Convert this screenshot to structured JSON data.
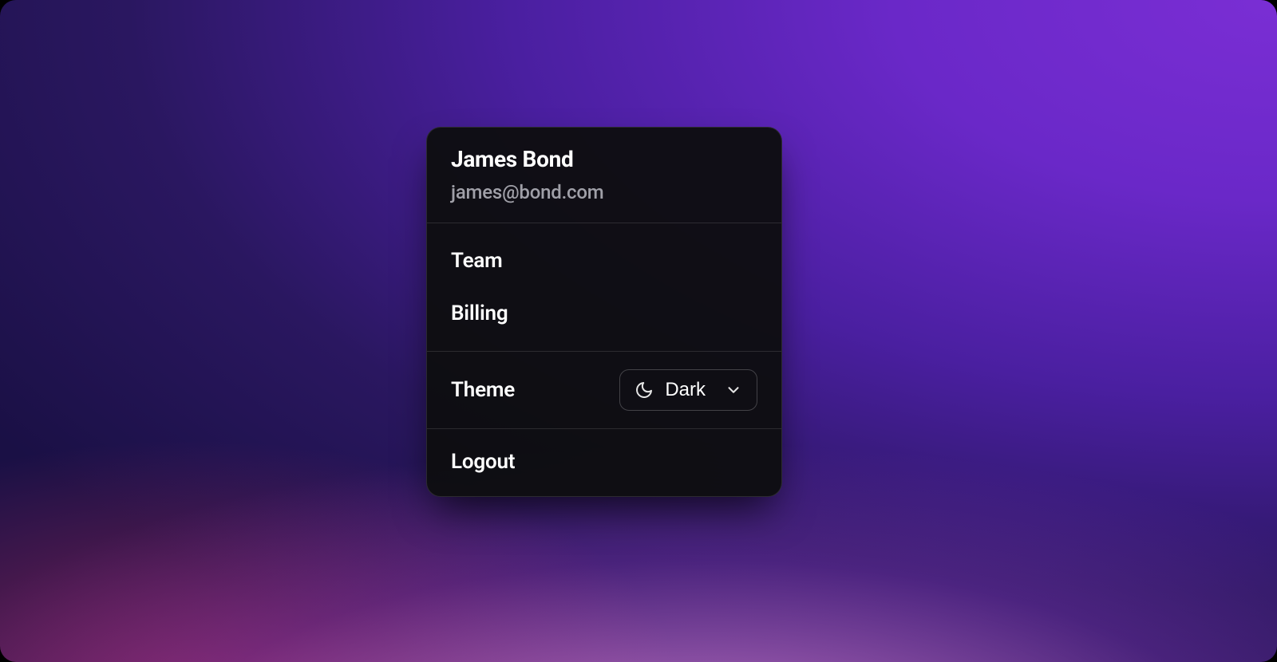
{
  "user": {
    "name": "James Bond",
    "email": "james@bond.com"
  },
  "menu": {
    "items": [
      {
        "label": "Team"
      },
      {
        "label": "Billing"
      }
    ],
    "theme": {
      "label": "Theme",
      "selected": "Dark",
      "icon": "moon-icon"
    },
    "logout": {
      "label": "Logout"
    }
  },
  "colors": {
    "panel_bg": "#0e0e10",
    "text_primary": "#ffffff",
    "text_secondary": "#a0a0a8",
    "border": "rgba(255,255,255,0.12)"
  }
}
